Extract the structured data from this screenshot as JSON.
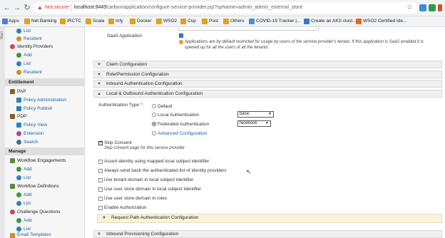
{
  "browser": {
    "security_label": "Not secure",
    "url_host": "localhost:9445",
    "url_path": "/carbon/application/configure-service-provider.jsp?spName=admin_admin_external_store"
  },
  "bookmarks": [
    "Apps",
    "Net Banking",
    "IRCTC",
    "Scala",
    "Infy",
    "Docker",
    "WSO2",
    "Cup",
    "Post",
    "Others",
    "COVID-19 Tracker |...",
    "Create an AKS clust...",
    "WSO2 Certified Ide..."
  ],
  "sidebar": {
    "top_items": [
      "List",
      "Resident"
    ],
    "identity_providers": {
      "title": "Identity Providers",
      "items": [
        "Add",
        "List",
        "Resident"
      ]
    },
    "entitlement": {
      "title": "Entitlement",
      "pap": "PAP",
      "pap_items": [
        "Policy Administration",
        "Policy Publish"
      ],
      "pdp": "PDP",
      "pdp_items": [
        "Policy View",
        "Extension",
        "Search"
      ]
    },
    "manage": {
      "title": "Manage",
      "workflow_engagements": "Workflow Engagements",
      "we_items": [
        "Add",
        "List"
      ],
      "workflow_definitions": "Workflow Definitions",
      "wd_items": [
        "Add",
        "List"
      ],
      "challenge_questions": "Challenge Questions",
      "cq_items": [
        "Add",
        "List"
      ],
      "email_templates": "Email Templates"
    },
    "strip_label": "Main"
  },
  "main": {
    "saas_label": "SaaS Application",
    "saas_desc_1": "Applications are by default restricted for usage by users of the service provider's tenant. If this application is SaaS enabled it is",
    "saas_desc_2": "opened up for all the users of all the tenants.",
    "sections": [
      "Claim Configuration",
      "Role/Permission Configuration",
      "Inbound Authentication Configuration",
      "Local & Outbound Authentication Configuration"
    ],
    "auth_type_label": "Authentication Type",
    "required_mark": "*",
    "auth_options": [
      "Default",
      "Local Authentication",
      "Federated Authentication",
      "Advanced Configuration"
    ],
    "local_select": "basic",
    "federated_select": "facebook",
    "skip_consent_label": "Skip Consent",
    "skip_consent_desc": "Skip consent page for this service provider",
    "options": [
      "Assert identity using mapped local subject identifier",
      "Always send back the authenticated list of identity providers",
      "Use tenant domain in local subject identifier",
      "Use user store domain in local subject identifier",
      "Use user store domain in roles",
      "Enable Authorization"
    ],
    "request_path": "Request Path Authentication Configuration",
    "inbound_provisioning": "Inbound Provisioning Configuration"
  },
  "colors": {
    "accent": "#1a5fa3",
    "add_icon": "#3a9a3a",
    "list_icon": "#2f7fc0",
    "warning": "#d93025",
    "request_path_bg": "#f7f3dc"
  }
}
